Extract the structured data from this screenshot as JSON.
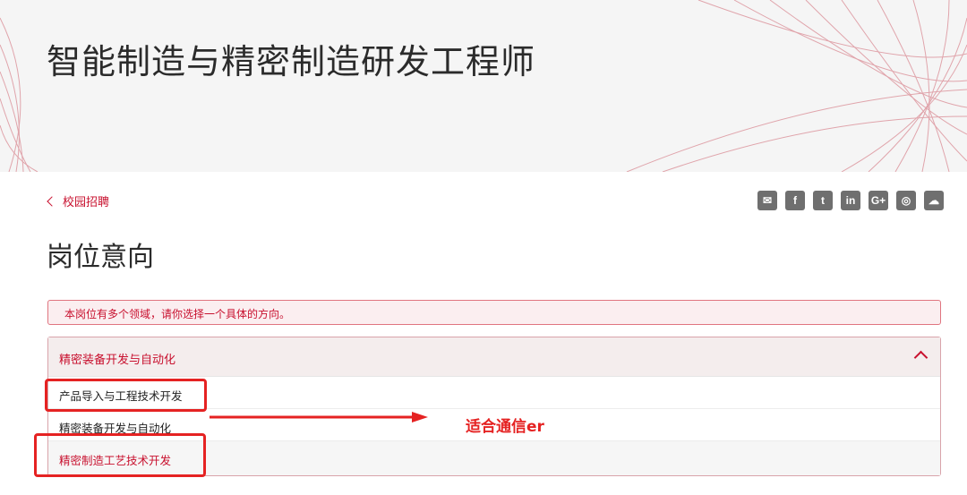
{
  "hero": {
    "title": "智能制造与精密制造研发工程师"
  },
  "nav": {
    "back_label": "校园招聘"
  },
  "share": {
    "icons": [
      {
        "name": "email-icon",
        "glyph": "✉"
      },
      {
        "name": "facebook-icon",
        "glyph": "f"
      },
      {
        "name": "twitter-icon",
        "glyph": "t"
      },
      {
        "name": "linkedin-icon",
        "glyph": "in"
      },
      {
        "name": "googleplus-icon",
        "glyph": "G+"
      },
      {
        "name": "weibo-icon",
        "glyph": "◎"
      },
      {
        "name": "wechat-icon",
        "glyph": "☁"
      }
    ]
  },
  "section": {
    "title": "岗位意向"
  },
  "notice": {
    "text": "本岗位有多个领域，请你选择一个具体的方向。"
  },
  "dropdown": {
    "selected": "精密装备开发与自动化",
    "options": [
      "产品导入与工程技术开发",
      "精密装备开发与自动化",
      "精密制造工艺技术开发"
    ]
  },
  "annotation": {
    "text": "适合通信er",
    "color": "#e52222"
  },
  "colors": {
    "accent": "#c8102e",
    "highlight": "#e52222",
    "icon_gray": "#6f6f6f"
  }
}
